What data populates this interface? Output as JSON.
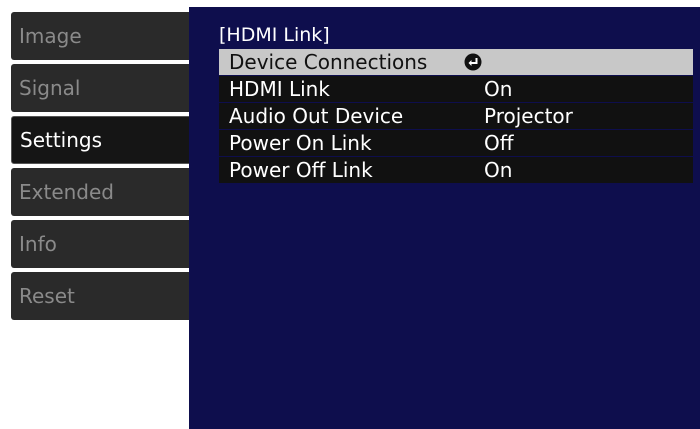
{
  "sidebar": {
    "items": [
      {
        "label": "Image"
      },
      {
        "label": "Signal"
      },
      {
        "label": "Settings"
      },
      {
        "label": "Extended"
      },
      {
        "label": "Info"
      },
      {
        "label": "Reset"
      }
    ],
    "active": "Settings"
  },
  "panel": {
    "title": "[HDMI Link]",
    "rows": [
      {
        "label": "Device Connections",
        "value": "",
        "icon": "enter-icon"
      },
      {
        "label": "HDMI Link",
        "value": "On"
      },
      {
        "label": "Audio Out Device",
        "value": "Projector"
      },
      {
        "label": "Power On Link",
        "value": "Off"
      },
      {
        "label": "Power Off Link",
        "value": "On"
      }
    ]
  },
  "colors": {
    "panel_bg": "#0e0e4d",
    "nav_bg": "#2a2a2a",
    "nav_active_bg": "#151515",
    "selected_row_bg": "#c8c8c8"
  }
}
